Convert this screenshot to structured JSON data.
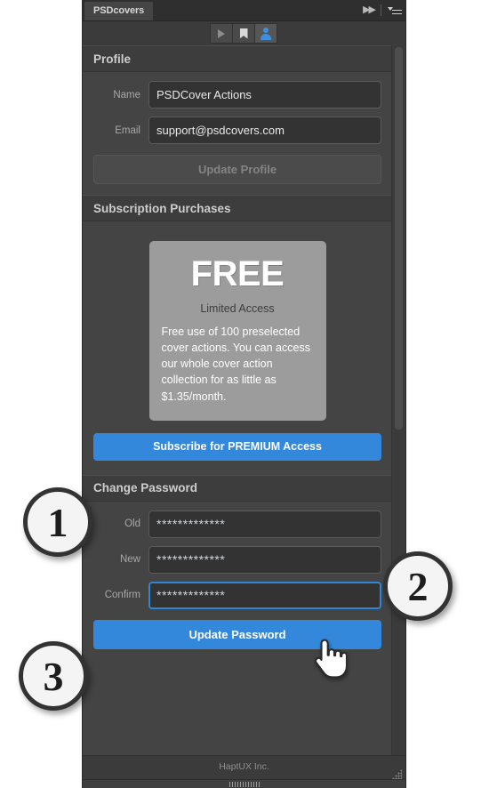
{
  "window": {
    "tab_label": "PSDcovers",
    "collapse_icon": "double-chevron-right-icon",
    "menu_icon": "panel-menu-icon"
  },
  "toolbar": {
    "buttons": [
      {
        "name": "play-button",
        "icon": "play-icon",
        "active": false
      },
      {
        "name": "bookmark-button",
        "icon": "bookmark-icon",
        "active": false
      },
      {
        "name": "account-button",
        "icon": "person-icon",
        "active": true
      }
    ]
  },
  "sections": {
    "profile": {
      "title": "Profile",
      "name_label": "Name",
      "name_value": "PSDCover Actions",
      "email_label": "Email",
      "email_value": "support@psdcovers.com",
      "update_button": "Update Profile"
    },
    "subscription": {
      "title": "Subscription Purchases",
      "card_title": "FREE",
      "card_subtitle": "Limited Access",
      "card_description": "Free use of 100 preselected cover actions. You can access our whole cover action collection for as little as $1.35/month.",
      "subscribe_button": "Subscribe for PREMIUM Access"
    },
    "change_password": {
      "title": "Change Password",
      "old_label": "Old",
      "old_value": "*************",
      "new_label": "New",
      "new_value": "*************",
      "confirm_label": "Confirm",
      "confirm_value": "*************",
      "update_button": "Update Password"
    }
  },
  "footer": {
    "text": "HaptUX Inc.",
    "resize_grip_icon": "resize-grip-icon"
  },
  "callouts": [
    {
      "number": "1"
    },
    {
      "number": "2"
    },
    {
      "number": "3"
    }
  ],
  "cursor": {
    "icon": "pointing-hand-cursor"
  },
  "colors": {
    "accent_blue": "#3488db",
    "focus_blue": "#2f86d6",
    "panel_bg": "#444444",
    "header_bg": "#3d3d3d",
    "field_bg": "#333333",
    "card_gray": "#9c9c9c"
  }
}
